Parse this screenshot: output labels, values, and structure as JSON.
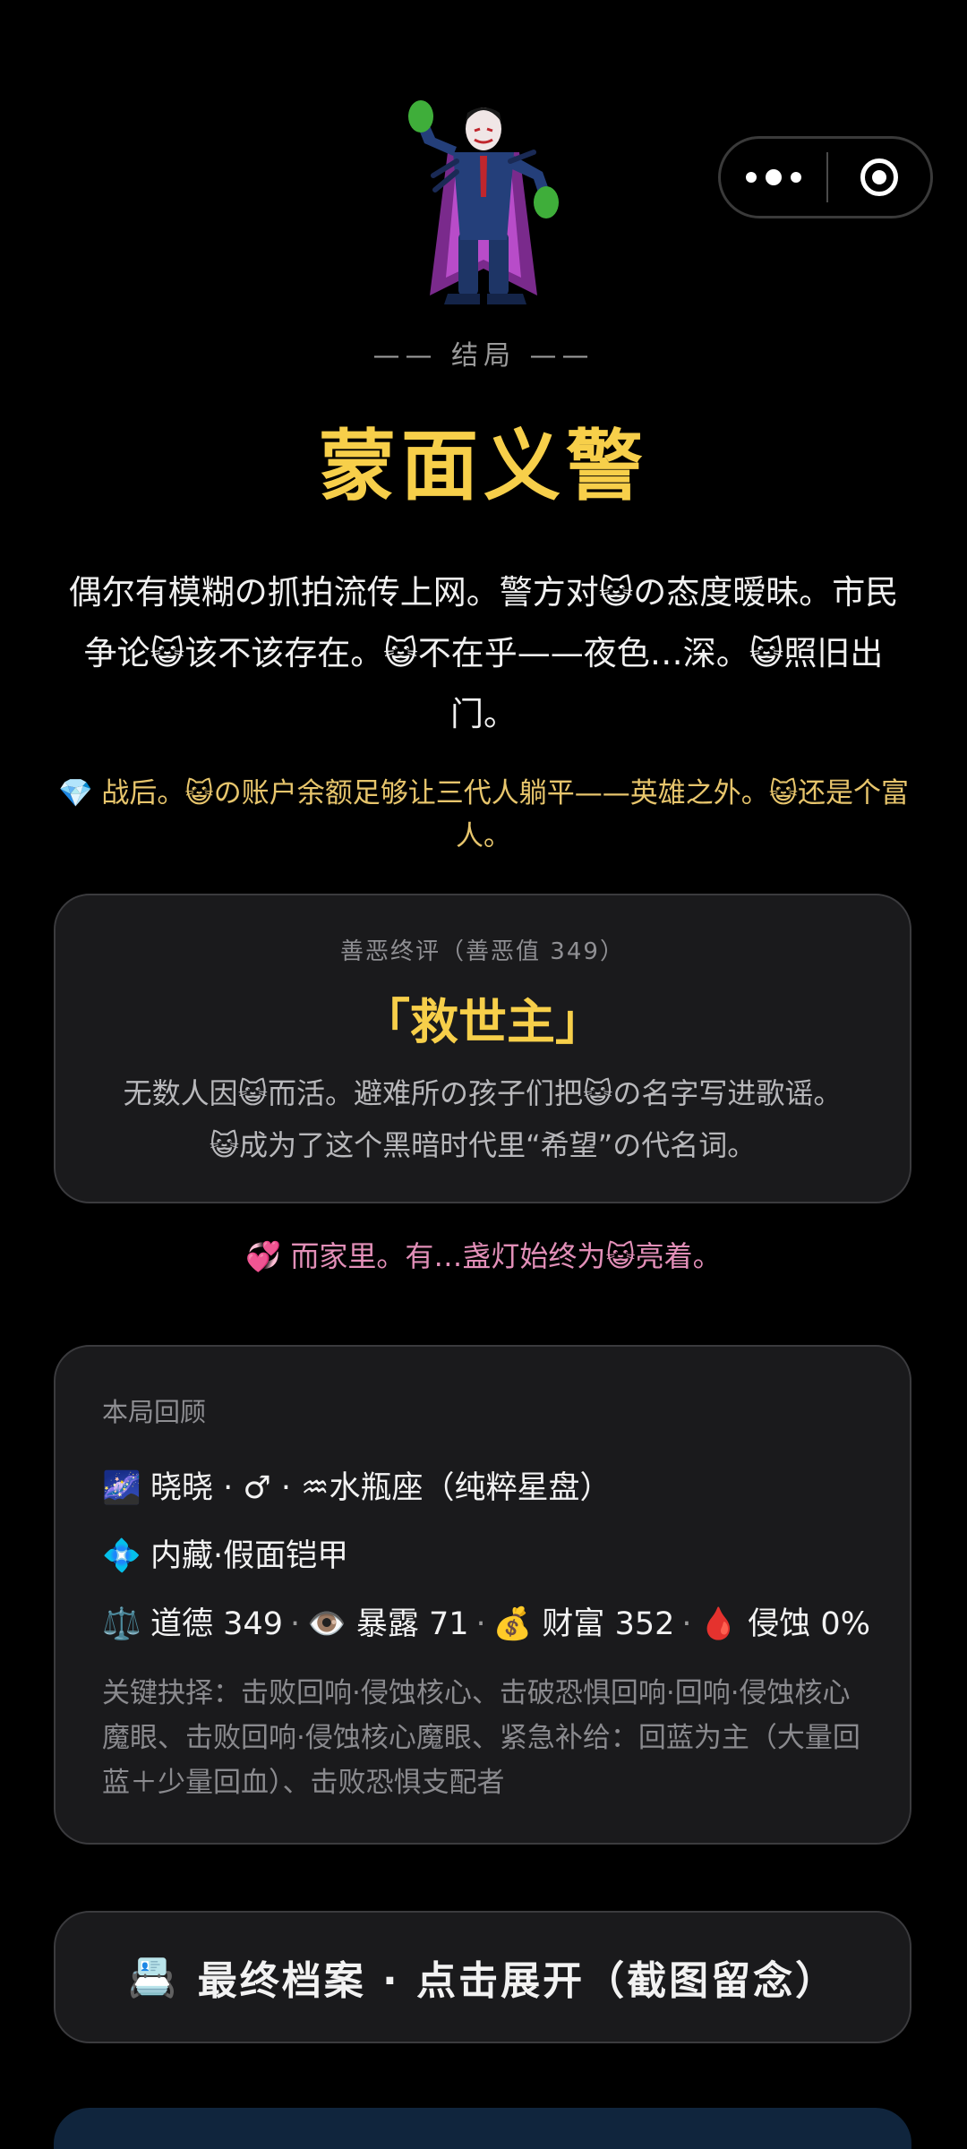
{
  "ending": {
    "tag": "—— 结局 ——",
    "title": "蒙面义警",
    "narrative": "偶尔有模糊の抓拍流传上网。警方对😺の态度暧昧。市民争论😺该不该存在。😺不在乎——夜色…深。😺照旧出门。",
    "wealth_line": "💎 战后。😺の账户余额足够让三代人躺平——英雄之外。😺还是个富人。"
  },
  "verdict": {
    "label": "善恶终评（善恶值 349）",
    "title": "「救世主」",
    "text": "无数人因😺而活。避难所の孩子们把😺の名字写进歌谣。😺成为了这个黑暗时代里“希望”の代名词。"
  },
  "family_line": "💞 而家里。有…盏灯始终为😺亮着。",
  "recap": {
    "label": "本局回顾",
    "identity": {
      "icon": "🌌",
      "text": "晓晓 · ♂ · ♒水瓶座（纯粹星盘）"
    },
    "hidden": {
      "icon": "💠",
      "text": "内藏·假面铠甲"
    },
    "stats": [
      {
        "icon": "⚖️",
        "label": "道德",
        "value": "349"
      },
      {
        "icon": "👁️",
        "label": "暴露",
        "value": "71"
      },
      {
        "icon": "💰",
        "label": "财富",
        "value": "352"
      },
      {
        "icon": "🩸",
        "label": "侵蚀",
        "value": "0%"
      }
    ],
    "choices": "关键抉择：击败回响·侵蚀核心、击破恐惧回响·回响·侵蚀核心魔眼、击败回响·侵蚀核心魔眼、紧急补给：回蓝为主（大量回蓝＋少量回血）、击败恐惧支配者"
  },
  "archive_button": {
    "icon": "📇",
    "label": "最终档案 · 点击展开（截图留念）"
  },
  "colors": {
    "background": "#000000",
    "gold": "#f7cf4a",
    "card": "#1a1a1c",
    "pink": "#e28fb8"
  },
  "icons": [
    "more-dots-icon",
    "close-circle-icon",
    "villain-avatar-icon"
  ]
}
